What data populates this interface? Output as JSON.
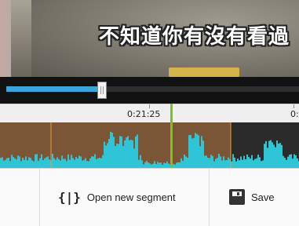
{
  "video": {
    "subtitle": "不知道你有沒有看過"
  },
  "scrubber": {
    "progress_percent": 31
  },
  "timeline": {
    "tick_labels": [
      "0:21:25",
      "0:"
    ]
  },
  "toolbar": {
    "open_segment_label": "Open new segment",
    "save_label": "Save"
  },
  "colors": {
    "accent_blue": "#3aa7dc",
    "segment_brown": "#7a5636",
    "playhead_green": "#7ec11e",
    "waveform_cyan": "#2fc4d6",
    "segment_boundary": "#e0a23c"
  }
}
